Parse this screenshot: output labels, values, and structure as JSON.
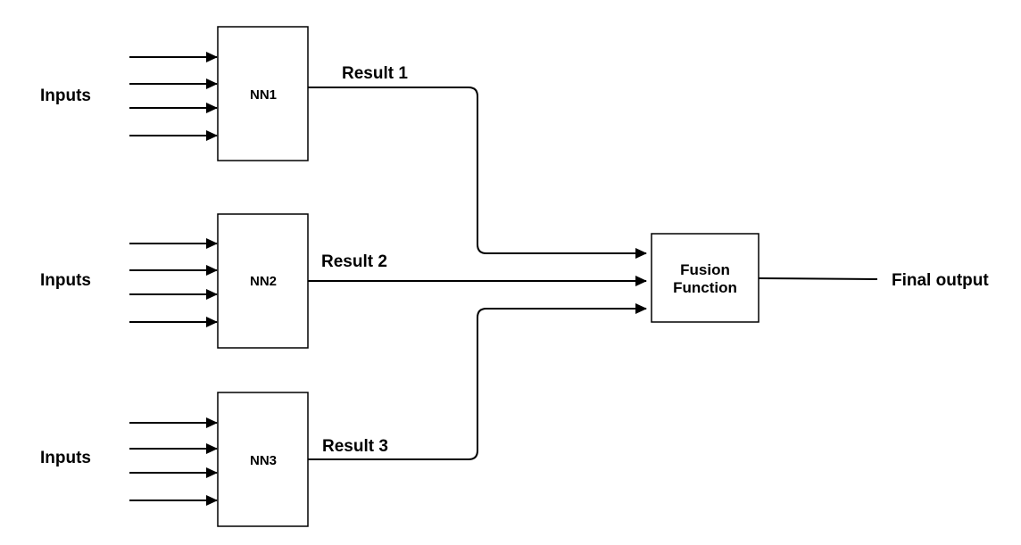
{
  "networks": [
    {
      "id": "nn1",
      "name": "NN1",
      "inputs_label": "Inputs",
      "result_label": "Result 1",
      "input_count": 4
    },
    {
      "id": "nn2",
      "name": "NN2",
      "inputs_label": "Inputs",
      "result_label": "Result 2",
      "input_count": 4
    },
    {
      "id": "nn3",
      "name": "NN3",
      "inputs_label": "Inputs",
      "result_label": "Result 3",
      "input_count": 4
    }
  ],
  "fusion": {
    "line1": "Fusion",
    "line2": "Function"
  },
  "output": {
    "label": "Final output"
  },
  "colors": {
    "stroke": "#000000",
    "background": "#ffffff"
  }
}
